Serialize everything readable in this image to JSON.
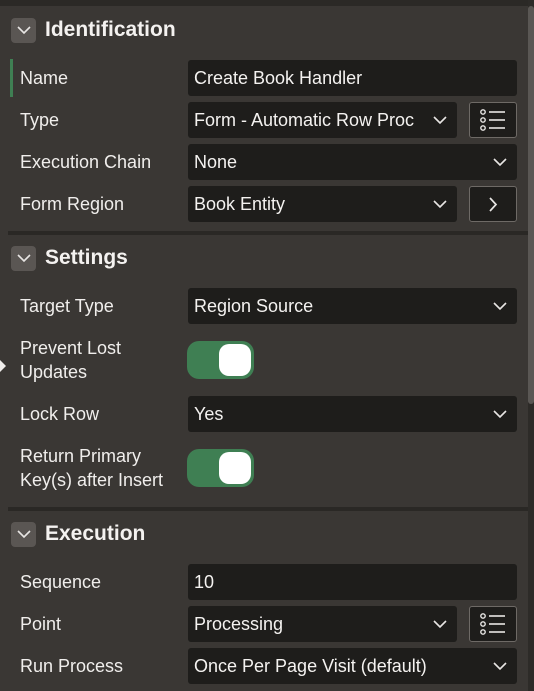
{
  "sections": {
    "identification": {
      "title": "Identification",
      "name_label": "Name",
      "name_value": "Create Book Handler",
      "type_label": "Type",
      "type_value": "Form - Automatic Row Proc",
      "execution_chain_label": "Execution Chain",
      "execution_chain_value": "None",
      "form_region_label": "Form Region",
      "form_region_value": "Book Entity"
    },
    "settings": {
      "title": "Settings",
      "target_type_label": "Target Type",
      "target_type_value": "Region Source",
      "prevent_lost_updates_label_line1": "Prevent Lost",
      "prevent_lost_updates_label_line2": "Updates",
      "prevent_lost_updates_on": true,
      "lock_row_label": "Lock Row",
      "lock_row_value": "Yes",
      "return_pk_label_line1": "Return Primary",
      "return_pk_label_line2": "Key(s) after Insert",
      "return_pk_on": true
    },
    "execution": {
      "title": "Execution",
      "sequence_label": "Sequence",
      "sequence_value": "10",
      "point_label": "Point",
      "point_value": "Processing",
      "run_process_label": "Run Process",
      "run_process_value": "Once Per Page Visit (default)"
    }
  },
  "colors": {
    "panel_bg": "#3a3734",
    "field_bg": "#1e1d1b",
    "toggle_on": "#3f7f53",
    "text": "#f2f0ee"
  },
  "icons": {
    "collapse": "chevron-down-icon",
    "list": "list-icon",
    "select": "chevron-down-icon",
    "go": "chevron-right-icon"
  }
}
